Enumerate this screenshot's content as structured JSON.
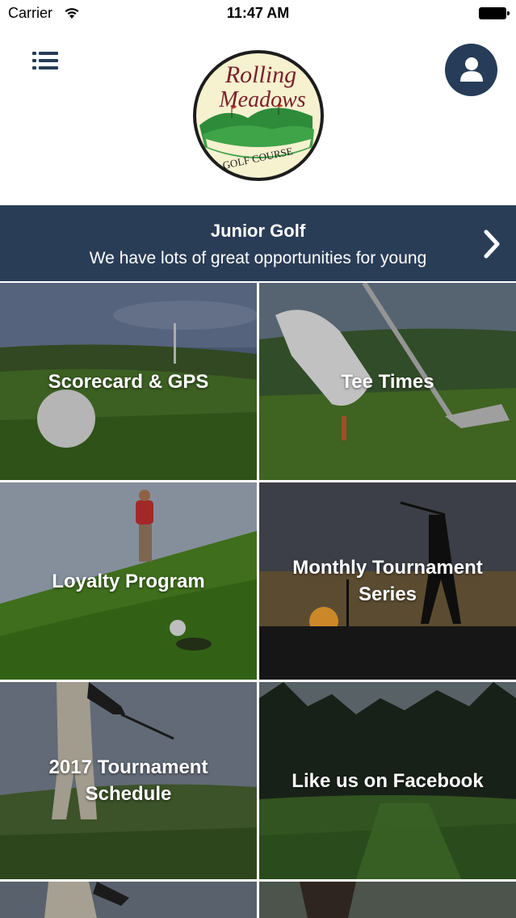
{
  "status_bar": {
    "carrier": "Carrier",
    "time": "11:47 AM"
  },
  "header": {
    "logo": {
      "line1": "Rolling",
      "line2": "Meadows",
      "line3": "GOLF COURSE"
    },
    "menu_icon": "list-icon",
    "profile_icon": "user-icon"
  },
  "banner": {
    "title": "Junior Golf",
    "subtitle": "We have lots of great opportunities for young",
    "chevron_icon": "chevron-right-icon"
  },
  "tiles": [
    {
      "label": "Scorecard & GPS"
    },
    {
      "label": "Tee Times"
    },
    {
      "label": "Loyalty Program"
    },
    {
      "label": "Monthly Tournament Series"
    },
    {
      "label": "2017 Tournament Schedule"
    },
    {
      "label": "Like us on Facebook"
    },
    {
      "label": ""
    },
    {
      "label": ""
    }
  ],
  "colors": {
    "navy": "#263c58",
    "banner": "#2a3d57",
    "logo_green": "#2e8b3a",
    "logo_maroon": "#7a1f2b",
    "logo_cream": "#f6f1cf"
  }
}
